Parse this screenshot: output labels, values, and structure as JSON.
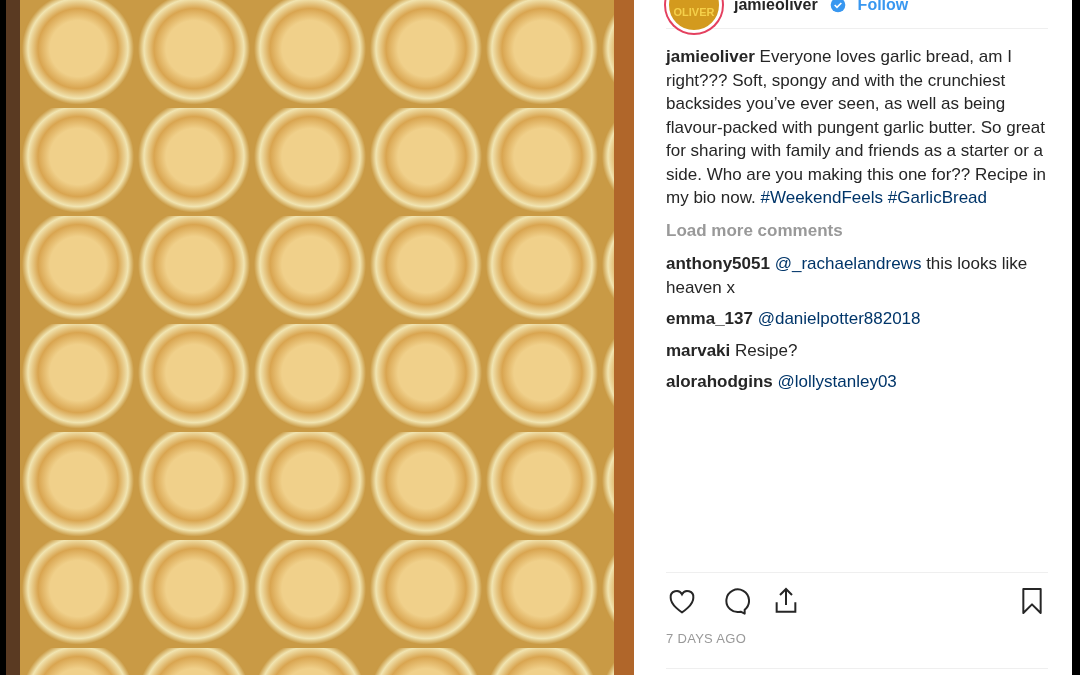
{
  "header": {
    "avatar_text": "OLIVER",
    "username": "jamieoliver",
    "verified": true,
    "follow": "Follow"
  },
  "caption": {
    "username": "jamieoliver",
    "text": "Everyone loves garlic bread, am I right??? Soft, spongy and with the crunchiest backsides you’ve ever seen, as well as being flavour-packed with pungent garlic butter. So great for sharing with family and friends as a starter or a side. Who are you making this one for?? Recipe in my bio now.",
    "hashtags": [
      "#WeekendFeels",
      "#GarlicBread"
    ]
  },
  "load_more": "Load more comments",
  "comments": [
    {
      "username": "anthony5051",
      "mention": "@_rachaelandrews",
      "text": "this looks like heaven x"
    },
    {
      "username": "emma_137",
      "mention": "@danielpotter882018"
    },
    {
      "username": "marvaki",
      "text": "Resipe?"
    },
    {
      "username": "alorahodgins",
      "mention": "@lollystanley03"
    }
  ],
  "actions": {
    "liked": false,
    "saved": false
  },
  "timestamp": "7 DAYS AGO"
}
